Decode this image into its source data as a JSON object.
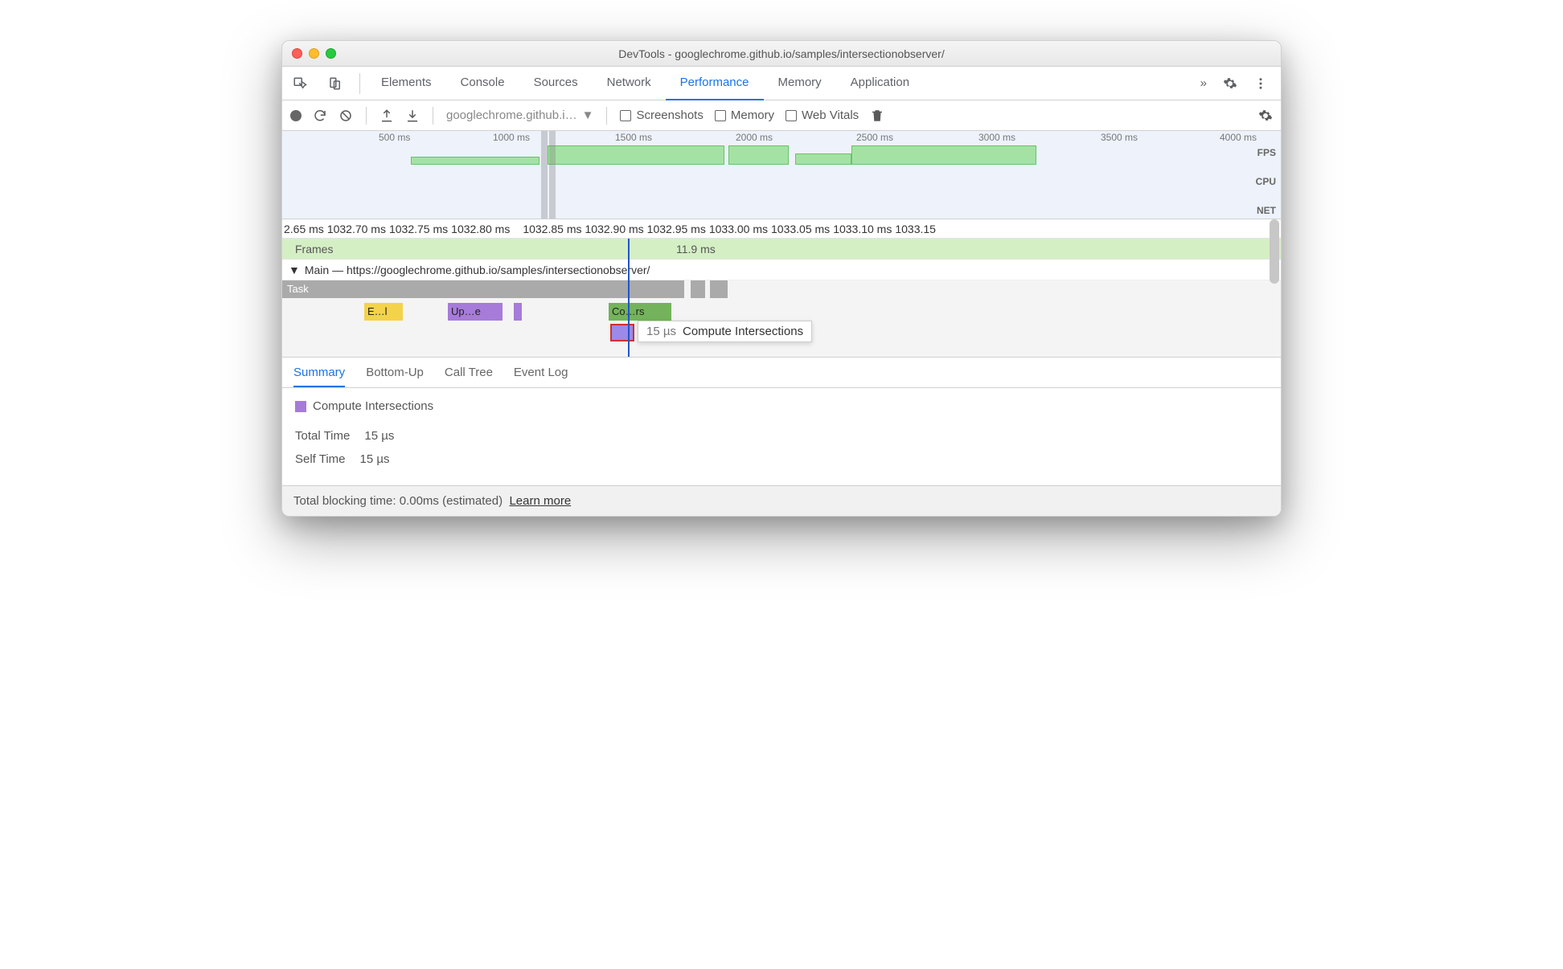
{
  "titlebar": {
    "title": "DevTools - googlechrome.github.io/samples/intersectionobserver/"
  },
  "tabs": [
    "Elements",
    "Console",
    "Sources",
    "Network",
    "Performance",
    "Memory",
    "Application"
  ],
  "active_tab": "Performance",
  "toolbar": {
    "source": "googlechrome.github.i…",
    "screenshots": "Screenshots",
    "memory": "Memory",
    "webvitals": "Web Vitals"
  },
  "overview": {
    "ticks": [
      "500 ms",
      "1000 ms",
      "1500 ms",
      "2000 ms",
      "2500 ms",
      "3000 ms",
      "3500 ms",
      "4000 ms"
    ],
    "lanes": [
      "FPS",
      "CPU",
      "NET"
    ]
  },
  "flame_ruler": [
    "2.65 ms",
    "1032.70 ms",
    "1032.75 ms",
    "1032.80 ms",
    "1032.85 ms",
    "1032.90 ms",
    "1032.95 ms",
    "1033.00 ms",
    "1033.05 ms",
    "1033.10 ms",
    "1033.15"
  ],
  "frames": {
    "label": "Frames",
    "duration": "11.9 ms"
  },
  "main": {
    "label": "Main — https://googlechrome.github.io/samples/intersectionobserver/"
  },
  "flame": {
    "task": "Task",
    "seg1": "E…l",
    "seg2": "Up…e",
    "seg3": "Co…rs"
  },
  "tooltip": {
    "duration": "15 µs",
    "name": "Compute Intersections"
  },
  "detail_tabs": [
    "Summary",
    "Bottom-Up",
    "Call Tree",
    "Event Log"
  ],
  "summary": {
    "name": "Compute Intersections",
    "total_label": "Total Time",
    "total_value": "15 µs",
    "self_label": "Self Time",
    "self_value": "15 µs"
  },
  "footer": {
    "text": "Total blocking time: 0.00ms (estimated)",
    "link": "Learn more"
  }
}
